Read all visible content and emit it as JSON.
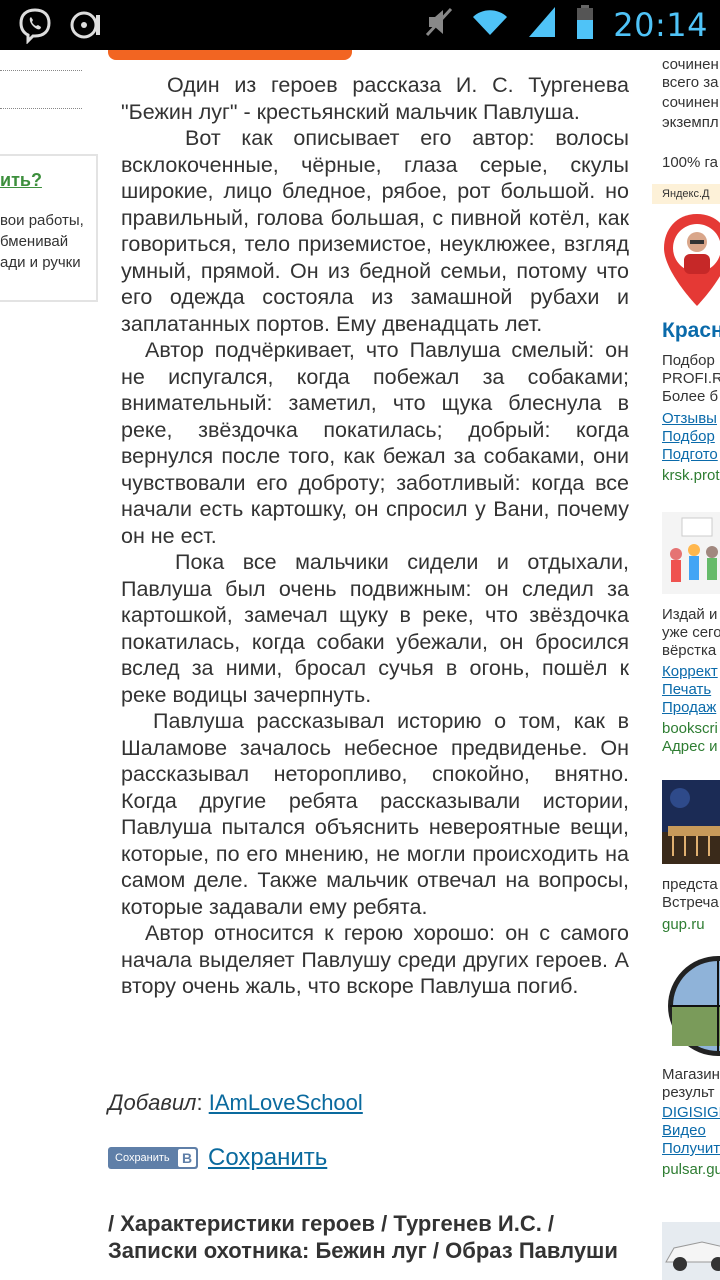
{
  "status_bar": {
    "time": "20:14",
    "icons": [
      "viber-icon",
      "music-disc-icon",
      "mute-icon",
      "wifi-icon",
      "signal-icon",
      "battery-icon"
    ]
  },
  "left_sidebar": {
    "box_title": "ить?",
    "box_lines": [
      "вои работы,",
      "бменивай",
      "ади и ручки"
    ]
  },
  "article": {
    "paragraphs": [
      "Один из героев рассказа И. С. Тургенева \"Бежин луг\" - крестьянский мальчик Павлуша.",
      "Вот как описывает его автор: волосы всклокоченные, чёрные, глаза серые, скулы широкие, лицо бледное, рябое, рот большой. но правильный, голова большая, с пивной котёл, как говориться, тело приземистое, неуклюжее, взгляд умный, прямой. Он из бедной семьи, потому что его одежда состояла из замашной рубахи и заплатанных портов. Ему двенадцать лет.",
      "Автор подчёркивает, что Павлуша смелый: он не испугался, когда побежал за собаками; внимательный: заметил, что щука блеснула в реке, звёздочка покатилась; добрый: когда вернулся после того, как бежал за собаками, они чувствовали его доброту; заботливый: когда все начали есть картошку, он спросил у Вани, почему он не ест.",
      "Пока все мальчики сидели и отдыхали, Павлуша был очень подвижным: он следил за картошкой, замечал щуку в реке, что звёздочка покатилась, когда собаки убежали, он бросился вслед за ними, бросал сучья в огонь, пошёл к реке водицы зачерпнуть.",
      "Павлуша рассказывал историю о том, как в Шаламове зачалось небесное предвиденье. Он рассказывал неторопливо, спокойно, внятно. Когда другие ребята рассказывали истории, Павлуша пытался объяснить невероятные вещи, которые, по его мнению, не могли происходить на самом деле. Также мальчик отвечал на вопросы, которые задавали ему ребята.",
      "Автор относится к герою хорошо: он с самого начала выделяет Павлушу среди других героев. А втору очень жаль, что вскоре Павлуша погиб."
    ],
    "added_by_label": "Добавил",
    "author_name": "IAmLoveSchool",
    "vk_button_label": "Сохранить",
    "vk_logo": "В",
    "save_link": "Сохранить",
    "tags": "/ Характеристики героев / Тургенев И.С. / Записки охотника: Бежин луг / Образ Павлуши"
  },
  "right_column": {
    "top_lines": [
      "сочинен",
      "всего за",
      "сочинен",
      "экземпл"
    ],
    "guarantee": "100% га",
    "yandex_bar": "Яндекс.Д",
    "ad1": {
      "title": "Красн",
      "lines": [
        "Подбор",
        "PROFI.R",
        "Более б"
      ],
      "links": [
        "Отзывы",
        "Подбор",
        "Подгото"
      ],
      "domain": "krsk.prot"
    },
    "ad2": {
      "lines": [
        "Издай и",
        "уже сего",
        "вёрстка"
      ],
      "links": [
        "Коррект",
        "Печать",
        "Продаж"
      ],
      "domain": "bookscri",
      "address": "Адрес и"
    },
    "ad3": {
      "lines": [
        "предста",
        "Встреча"
      ],
      "domain": "gup.ru"
    },
    "ad4": {
      "lines": [
        "Магазин",
        "результ"
      ],
      "links": [
        "DIGISIGH",
        "Видео",
        "Получит"
      ],
      "domain": "pulsar.gu"
    }
  },
  "colors": {
    "status_bar_bg": "#000000",
    "clock": "#4fc3f7",
    "link_blue": "#0a6a9e",
    "orange_button": "#f26522",
    "vk_button": "#5f7fa8",
    "ad_green": "#2e7d32"
  }
}
